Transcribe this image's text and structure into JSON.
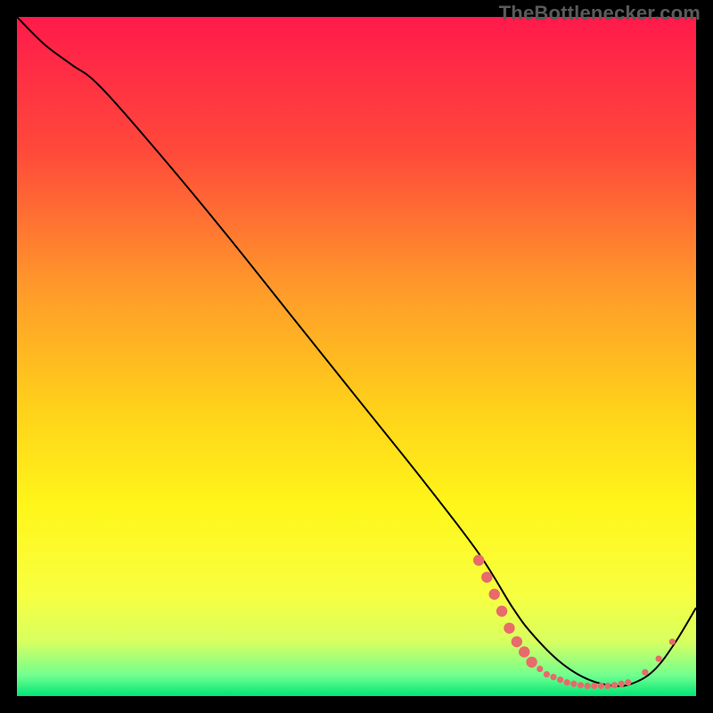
{
  "watermark": "TheBottlenecker.com",
  "chart_data": {
    "type": "line",
    "title": "",
    "xlabel": "",
    "ylabel": "",
    "xlim": [
      0,
      100
    ],
    "ylim": [
      0,
      100
    ],
    "grid": false,
    "legend": false,
    "background_gradient": [
      {
        "offset": 0.0,
        "color": "#ff1a4b"
      },
      {
        "offset": 0.2,
        "color": "#ff4a3a"
      },
      {
        "offset": 0.4,
        "color": "#ff9a2a"
      },
      {
        "offset": 0.58,
        "color": "#ffd21a"
      },
      {
        "offset": 0.72,
        "color": "#fff61a"
      },
      {
        "offset": 0.85,
        "color": "#f8ff40"
      },
      {
        "offset": 0.92,
        "color": "#d8ff60"
      },
      {
        "offset": 0.97,
        "color": "#70ff90"
      },
      {
        "offset": 1.0,
        "color": "#00e676"
      }
    ],
    "series": [
      {
        "name": "bottleneck-curve",
        "color": "#000000",
        "x": [
          0,
          4,
          8,
          12,
          20,
          30,
          40,
          50,
          60,
          68,
          73,
          76,
          80,
          84,
          88,
          91,
          94,
          97,
          100
        ],
        "y": [
          100,
          96,
          93,
          90,
          81,
          69,
          56.5,
          44,
          31.5,
          21,
          13,
          9,
          5,
          2.5,
          1.5,
          2,
          4,
          8,
          13
        ]
      }
    ],
    "markers": {
      "name": "bottleneck-points",
      "color": "#e86a6a",
      "radius_large": 6.2,
      "radius_small": 3.6,
      "points": [
        {
          "x": 68.0,
          "y": 20.0,
          "r": "large"
        },
        {
          "x": 69.2,
          "y": 17.5,
          "r": "large"
        },
        {
          "x": 70.3,
          "y": 15.0,
          "r": "large"
        },
        {
          "x": 71.4,
          "y": 12.5,
          "r": "large"
        },
        {
          "x": 72.5,
          "y": 10.0,
          "r": "large"
        },
        {
          "x": 73.6,
          "y": 8.0,
          "r": "large"
        },
        {
          "x": 74.7,
          "y": 6.5,
          "r": "large"
        },
        {
          "x": 75.8,
          "y": 5.0,
          "r": "large"
        },
        {
          "x": 77.0,
          "y": 4.0,
          "r": "small"
        },
        {
          "x": 78.0,
          "y": 3.2,
          "r": "small"
        },
        {
          "x": 79.0,
          "y": 2.8,
          "r": "small"
        },
        {
          "x": 80.0,
          "y": 2.4,
          "r": "small"
        },
        {
          "x": 81.0,
          "y": 2.0,
          "r": "small"
        },
        {
          "x": 82.0,
          "y": 1.8,
          "r": "small"
        },
        {
          "x": 83.0,
          "y": 1.6,
          "r": "small"
        },
        {
          "x": 84.0,
          "y": 1.5,
          "r": "small"
        },
        {
          "x": 85.0,
          "y": 1.5,
          "r": "small"
        },
        {
          "x": 86.0,
          "y": 1.5,
          "r": "small"
        },
        {
          "x": 87.0,
          "y": 1.5,
          "r": "small"
        },
        {
          "x": 88.0,
          "y": 1.6,
          "r": "small"
        },
        {
          "x": 89.0,
          "y": 1.8,
          "r": "small"
        },
        {
          "x": 90.0,
          "y": 2.0,
          "r": "small"
        },
        {
          "x": 92.5,
          "y": 3.5,
          "r": "small"
        },
        {
          "x": 94.5,
          "y": 5.5,
          "r": "small"
        },
        {
          "x": 96.5,
          "y": 8.0,
          "r": "small"
        }
      ]
    }
  }
}
